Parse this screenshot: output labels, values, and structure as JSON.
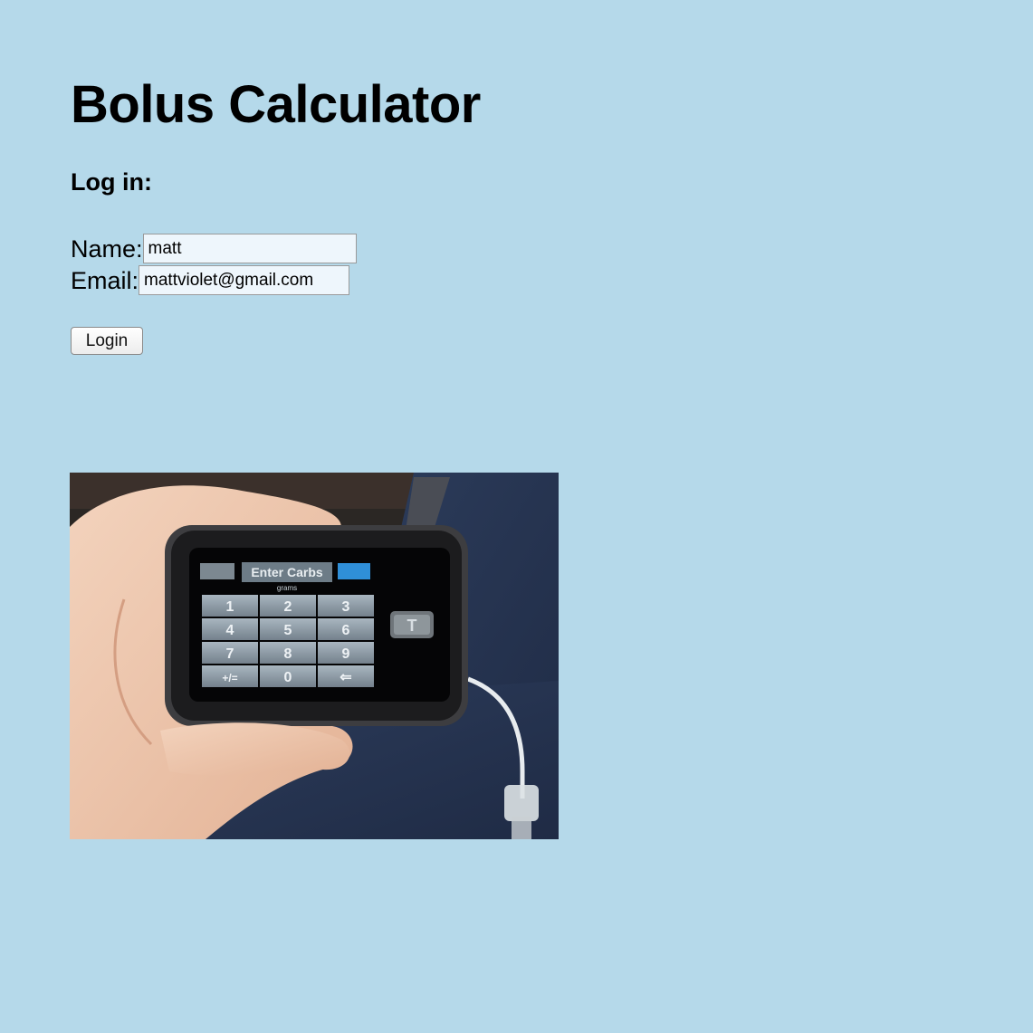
{
  "page": {
    "title": "Bolus Calculator",
    "subheading": "Log in:"
  },
  "form": {
    "name_label": "Name:",
    "name_value": "matt",
    "email_label": "Email:",
    "email_value": "mattviolet@gmail.com",
    "login_label": "Login"
  },
  "photo": {
    "device_screen_title": "Enter Carbs",
    "device_screen_unit": "grams",
    "keypad_keys": [
      "1",
      "2",
      "3",
      "4",
      "5",
      "6",
      "7",
      "8",
      "9",
      "+/=",
      "0",
      "⇐"
    ],
    "side_button_letter": "T"
  },
  "colors": {
    "background": "#b5d9ea",
    "device_accent": "#2f8fd8"
  }
}
